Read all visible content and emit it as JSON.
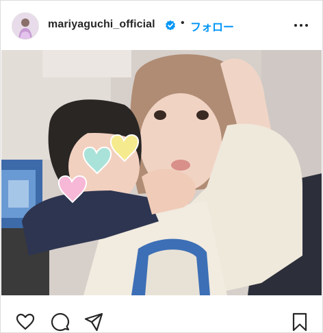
{
  "post": {
    "username": "mariyaguchi_official",
    "verified": true,
    "separator": "•",
    "follow_label": "フォロー",
    "avatar_icon": "profile-avatar",
    "more_icon": "more-options-icon",
    "accent_color": "#0095f6",
    "verified_color": "#0095f6"
  },
  "actions": {
    "like_icon": "heart-icon",
    "comment_icon": "comment-icon",
    "share_icon": "share-icon",
    "save_icon": "bookmark-icon"
  }
}
